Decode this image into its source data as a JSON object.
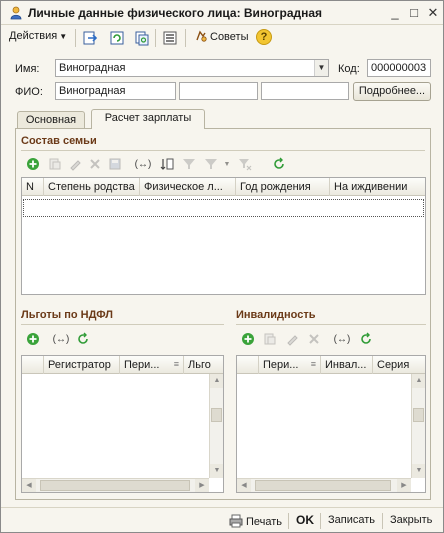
{
  "window": {
    "title": "Личные данные физического лица: Виноградная",
    "controls": {
      "minimize": "_",
      "maximize": "□",
      "close": "✕"
    }
  },
  "toolbar": {
    "actions_label": "Действия",
    "advice_label": "Советы",
    "help_label": "?"
  },
  "form": {
    "name_label": "Имя:",
    "name_value": "Виноградная",
    "code_label": "Код:",
    "code_value": "000000003",
    "fio_label": "ФИО:",
    "fio_last": "Виноградная",
    "fio_first": "",
    "fio_middle": "",
    "details_button": "Подробнее..."
  },
  "tabs": [
    {
      "label": "Основная",
      "active": false
    },
    {
      "label": "Расчет зарплаты",
      "active": true
    }
  ],
  "family": {
    "title": "Состав семьи",
    "columns": [
      "N",
      "Степень родства",
      "Физическое л...",
      "Год рождения",
      "На иждивении"
    ]
  },
  "ndfl": {
    "title": "Льготы по НДФЛ",
    "columns": [
      "",
      "Регистратор",
      "Пери...",
      "Льго"
    ]
  },
  "disability": {
    "title": "Инвалидность",
    "columns": [
      "",
      "Пери...",
      "Инвал...",
      "Серия"
    ]
  },
  "bottom": {
    "print_label": "Печать",
    "ok_label": "OK",
    "save_label": "Записать",
    "close_label": "Закрыть"
  },
  "colors": {
    "section_title": "#6b3a18",
    "add_icon": "#3aa33a",
    "refresh_icon": "#2f9b36"
  }
}
